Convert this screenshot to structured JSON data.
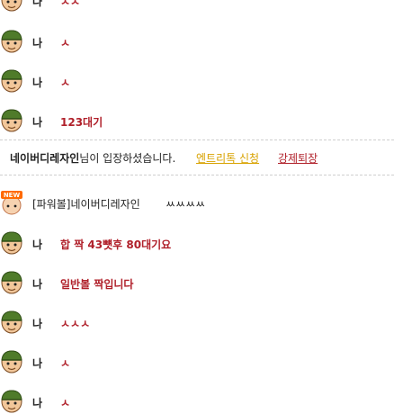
{
  "rows_top": [
    {
      "name": "나",
      "message": "ㅅㅅ"
    },
    {
      "name": "나",
      "message": "ㅅ"
    },
    {
      "name": "나",
      "message": "ㅅ"
    },
    {
      "name": "나",
      "message": "123대기"
    }
  ],
  "notice": {
    "user": "네이버디레자인",
    "text": "님이 입장하셨습니다.",
    "entry_link": "엔트리톡 신청",
    "kick_link": "강제퇴장"
  },
  "sender_row": {
    "badge": "NEW",
    "sender": "[파워볼]네이버디레자인",
    "message": "ㅆㅆㅆㅆ"
  },
  "rows_bottom": [
    {
      "name": "나",
      "message": "합 짝 43뻇후 80대기요"
    },
    {
      "name": "나",
      "message": "일반볼 짝입니다"
    },
    {
      "name": "나",
      "message": "ㅅㅅㅅ"
    },
    {
      "name": "나",
      "message": "ㅅ"
    },
    {
      "name": "나",
      "message": "ㅅ"
    }
  ]
}
